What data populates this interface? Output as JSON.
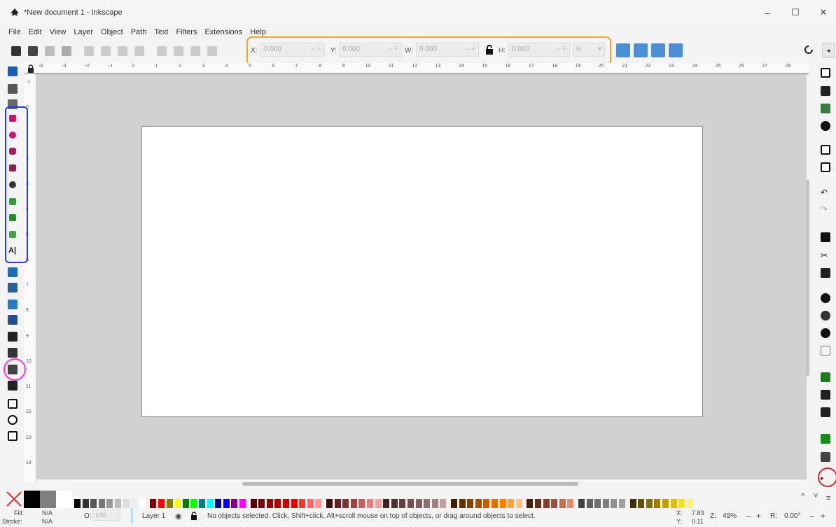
{
  "window": {
    "title": "*New document 1 - Inkscape",
    "controls": {
      "minimize": "–",
      "maximize": "☐",
      "close": "✕"
    }
  },
  "menu": [
    "File",
    "Edit",
    "View",
    "Layer",
    "Object",
    "Path",
    "Text",
    "Filters",
    "Extensions",
    "Help"
  ],
  "commands": {
    "icons": [
      "select-all-icon",
      "select-all-layers-icon",
      "deselect-icon",
      "transform-icon",
      "rotate-ccw-icon",
      "rotate-cw-icon",
      "flip-horizontal-icon",
      "flip-vertical-icon",
      "raise-to-top-icon",
      "raise-icon",
      "lower-icon",
      "lower-to-bottom-icon"
    ],
    "x": {
      "label": "X:",
      "value": "0.000"
    },
    "y": {
      "label": "Y:",
      "value": "0.000"
    },
    "w": {
      "label": "W:",
      "value": "0.000"
    },
    "h": {
      "label": "H:",
      "value": "0.000"
    },
    "lock_icon": "lock-icon",
    "unit": "in",
    "unit_caret": "▾",
    "stepper": "– +",
    "snap_buttons": [
      "scale-stroke-icon",
      "scale-corners-icon",
      "transform-gradients-icon",
      "transform-patterns-icon"
    ]
  },
  "tools": [
    "selector-icon",
    "node-icon",
    "tweak-icon",
    "rectangle-icon",
    "ellipse-icon",
    "star-icon",
    "3d-box-icon",
    "spiral-icon",
    "pencil-icon",
    "pen-icon",
    "calligraphy-icon",
    "text-icon",
    "gradient-icon",
    "mesh-icon",
    "dropper-icon",
    "paint-bucket-icon",
    "eraser-icon",
    "spray-icon",
    "measure-icon",
    "connector-icon",
    "page-icon",
    "zoom-icon",
    "pages-icon"
  ],
  "right_commands": [
    "new-document-icon",
    "open-icon",
    "save-icon",
    "print-icon",
    "import-icon",
    "export-icon",
    "undo-icon",
    "redo-icon",
    "copy-icon",
    "cut-icon",
    "paste-icon",
    "zoom-selection-icon",
    "zoom-drawing-icon",
    "zoom-page-icon",
    "zoom-page-width-icon",
    "duplicate-icon",
    "clone-icon",
    "unlink-clone-icon",
    "group-icon",
    "ungroup-icon",
    "more-commands-icon"
  ],
  "rulers": {
    "top": [
      "-4",
      "-3",
      "-2",
      "-1",
      "0",
      "1",
      "2",
      "3",
      "4",
      "5",
      "6",
      "7",
      "8",
      "9",
      "10",
      "11",
      "12",
      "13",
      "14",
      "15",
      "16",
      "17",
      "18",
      "19",
      "20",
      "21",
      "22",
      "23",
      "24",
      "25",
      "26",
      "27",
      "28"
    ],
    "left": [
      "-1",
      "0",
      "1",
      "2",
      "3",
      "4",
      "5",
      "6",
      "7",
      "8",
      "9",
      "10",
      "11",
      "12",
      "13",
      "14"
    ]
  },
  "palette": {
    "none_icon": "no-paint-icon",
    "swatches": [
      "#000000",
      "#333333",
      "#555555",
      "#777777",
      "#999999",
      "#bbbbbb",
      "#dddddd",
      "#eeeeee",
      "#ffffff",
      "#800000",
      "#ff0000",
      "#808000",
      "#ffff00",
      "#008000",
      "#00ff00",
      "#008080",
      "#00ffff",
      "#000080",
      "#0000ff",
      "#800080",
      "#ff00ff",
      "#5a0000",
      "#7a0000",
      "#990000",
      "#b30000",
      "#cc0000",
      "#e60000",
      "#ff3333",
      "#ff6666",
      "#ff9999",
      "#401010",
      "#602020",
      "#803030",
      "#a04040",
      "#c06060",
      "#e08080",
      "#f0a0a0",
      "#402020",
      "#503030",
      "#604040",
      "#705050",
      "#806060",
      "#907070",
      "#a08080",
      "#c0a0a0",
      "#402000",
      "#603000",
      "#804000",
      "#a05000",
      "#c06000",
      "#e07000",
      "#ff8000",
      "#ffa040",
      "#ffc080",
      "#402010",
      "#603020",
      "#804030",
      "#a05040",
      "#c07050",
      "#e09070",
      "#404040",
      "#606060",
      "#707070",
      "#808080",
      "#909090",
      "#a0a0a0",
      "#403000",
      "#605000",
      "#807000",
      "#a08000",
      "#c0a000",
      "#e0c000",
      "#ffe000",
      "#ffee80"
    ]
  },
  "status": {
    "fill_label": "Fill:",
    "fill_value": "N/A",
    "stroke_label": "Stroke:",
    "stroke_value": "N/A",
    "opacity_label": "O:",
    "opacity_value": "100",
    "layer": "Layer 1",
    "message": "No objects selected. Click, Shift+click, Alt+scroll mouse on top of objects, or drag around objects to select.",
    "x_label": "X:",
    "x_value": "7.83",
    "y_label": "Y:",
    "y_value": "0.11",
    "zoom_label": "Z:",
    "zoom_value": "49%",
    "rotate_label": "R:",
    "rotate_value": "0.00°",
    "minus": "–",
    "plus": "+"
  }
}
